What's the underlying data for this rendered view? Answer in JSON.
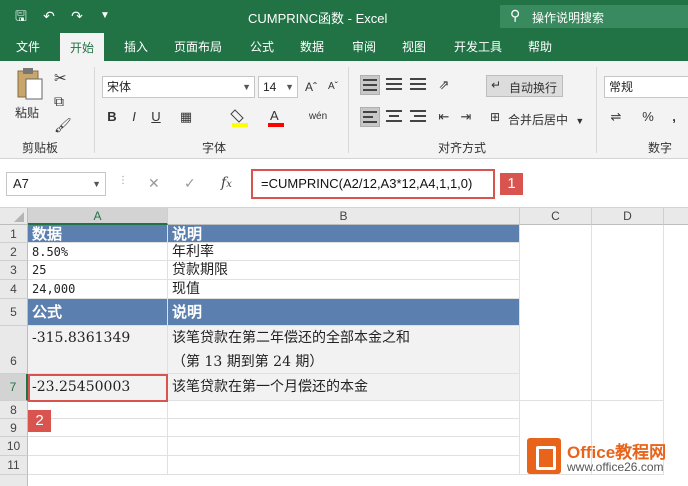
{
  "window": {
    "title": "CUMPRINC函数 - Excel",
    "tell_me": "操作说明搜索"
  },
  "tabs": [
    "文件",
    "开始",
    "插入",
    "页面布局",
    "公式",
    "数据",
    "审阅",
    "视图",
    "开发工具",
    "帮助"
  ],
  "ribbon": {
    "paste_label": "粘贴",
    "clipboard_group": "剪贴板",
    "font_name": "宋体",
    "font_size": "14",
    "bold": "B",
    "italic": "I",
    "underline": "U",
    "font_group": "字体",
    "wrap_text": "自动换行",
    "merge_center": "合并后居中",
    "align_group": "对齐方式",
    "number_format": "常规",
    "percent": "%",
    "number_group": "数字",
    "font_color_hex": "#ff0000",
    "fill_color_hex": "#ffff00"
  },
  "formula_bar": {
    "name_box": "A7",
    "formula": "=CUMPRINC(A2/12,A3*12,A4,1,1,0)",
    "badge": "1"
  },
  "grid": {
    "columns": [
      "A",
      "B",
      "C",
      "D"
    ],
    "rows": [
      "1",
      "2",
      "3",
      "4",
      "5",
      "6",
      "7",
      "8",
      "9",
      "10",
      "11"
    ],
    "cells": {
      "a1": "数据",
      "b1": "说明",
      "a2": "8.50%",
      "b2": "年利率",
      "a3": "25",
      "b3": "贷款期限",
      "a4": "24,000",
      "b4": "现值",
      "a5": "公式",
      "b5": "说明",
      "a6": "-315.8361349",
      "b6_line1": "该笔贷款在第二年偿还的全部本金之和",
      "b6_line2": "（第 13 期到第 24 期）",
      "a7": "-23.25450003",
      "b7": "该笔贷款在第一个月偿还的本金"
    },
    "badge": "2",
    "header_color": "#5b7fae"
  },
  "watermark": {
    "brand": "Office教程网",
    "url": "www.office26.com"
  }
}
